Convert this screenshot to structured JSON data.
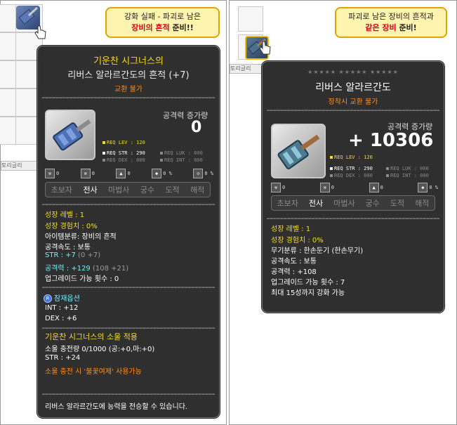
{
  "left": {
    "bubble": {
      "line1": "강화 실패 - 파괴로 남은",
      "line2_red": "장비의 흔적",
      "line2_tail": " 준비!!"
    },
    "inventory_label": "토리글리",
    "tooltip": {
      "prefix": "기운찬 시그너스의",
      "title": "리버스 알라르간도의 흔적 (+7)",
      "trade": "교환 불가",
      "attack_label": "공격력 증가량",
      "attack_value": "0",
      "req_lev": "REQ LEV : 120",
      "req_str": "REQ STR : 290",
      "req_dex": "REQ DEX : 000",
      "req_luk": "REQ LUK : 000",
      "req_int": "REQ INT : 000",
      "icons": [
        "0",
        "0",
        "0",
        "0 %",
        "0 %"
      ],
      "jobs": [
        "초보자",
        "전사",
        "마법사",
        "궁수",
        "도적",
        "해적"
      ],
      "active_job": "전사",
      "growth_level": "성장 레벨 : 1",
      "growth_exp": "성장 경험치 : 0%",
      "category": "아이템분류: 장비의 흔적",
      "speed": "공격속도 : 보통",
      "str_line": "STR : +7",
      "str_detail": " (0 +7)",
      "atk_line": "공격력 : +129",
      "atk_detail": " (108 +21)",
      "upgrade": "업그레이드 가능 횟수 : 0",
      "potential_title": "잠재옵션",
      "potential_badge": "R",
      "pot1": "INT : +12",
      "pot2": "DEX : +6",
      "soul_title": "기운찬 시그너스의 소울 적용",
      "soul_charge": "소울 충전량 0/1000 (공:+0,마:+0)",
      "soul_str": "STR : +24",
      "soul_skill": "소울 충전 시 '불꽃여제' 사용가능",
      "footer": "리버스 알라르간도에 능력을 전승할 수 있습니다."
    }
  },
  "right": {
    "bubble": {
      "line1": "파괴로 남은 장비의 흔적과",
      "line2_red": "같은 장비",
      "line2_tail": " 준비!"
    },
    "inventory_label": "토리글리",
    "tooltip": {
      "stars": "★★★★★ ★★★★★ ★★★★★",
      "title": "리버스 알라르간도",
      "trade": "장착시 교환 불가",
      "attack_label": "공격력 증가량",
      "attack_value": "+ 10306",
      "req_lev": "REQ LEV : 120",
      "req_str": "REQ STR : 290",
      "req_dex": "REQ DEX : 000",
      "req_luk": "REQ LUK : 000",
      "req_int": "REQ INT : 000",
      "icons": [
        "0",
        "0",
        "0",
        "0 %"
      ],
      "jobs": [
        "초보자",
        "전사",
        "마법사",
        "궁수",
        "도적",
        "해적"
      ],
      "active_job": "전사",
      "growth_level": "성장 레벨 : 1",
      "growth_exp": "성장 경험치 : 0%",
      "category": "무기분류 : 한손둔기 (한손무기)",
      "speed": "공격속도 : 보통",
      "atk_line": "공격력 : +108",
      "upgrade": "업그레이드 가능 횟수 : 7",
      "enhance": "최대 15성까지 강화 가능"
    }
  },
  "colors": {
    "accent_yellow": "#f2dc24",
    "accent_orange": "#ff8c1c",
    "accent_cyan": "#6cf2ff",
    "bubble_border": "#e3a400",
    "bubble_red": "#d8001a"
  },
  "icon_names": [
    "hammer-icon",
    "hand-cursor-icon"
  ]
}
